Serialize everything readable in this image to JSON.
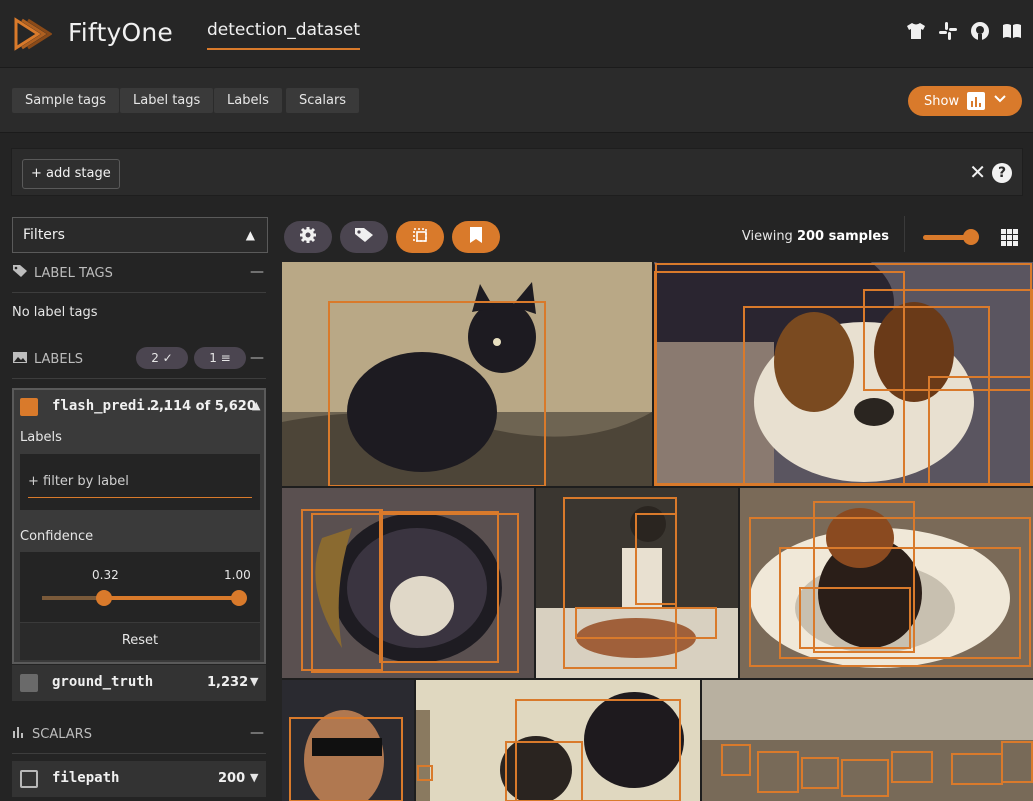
{
  "header": {
    "brand": "FiftyOne",
    "dataset_name": "detection_dataset",
    "icons": [
      "tshirt-icon",
      "slack-icon",
      "github-icon",
      "book-icon"
    ]
  },
  "tabs": [
    {
      "label": "Sample tags"
    },
    {
      "label": "Label tags"
    },
    {
      "label": "Labels"
    },
    {
      "label": "Scalars"
    }
  ],
  "show_button": {
    "label": "Show"
  },
  "stages": {
    "add_label": "+ add stage"
  },
  "sidebar": {
    "filters_title": "Filters",
    "label_tags": {
      "title": "LABEL TAGS",
      "empty_text": "No label tags"
    },
    "labels": {
      "title": "LABELS",
      "pill_checked": "2 ✓",
      "pill_filter": "1 ≡"
    },
    "flash_predictions": {
      "name": "flash_predi...",
      "count": "2,114 of 5,620",
      "labels_title": "Labels",
      "filter_placeholder": "+ filter by label",
      "confidence_title": "Confidence",
      "confidence_min": "0.32",
      "confidence_max": "1.00",
      "confidence_lower": 0.32,
      "confidence_upper": 1.0,
      "reset_label": "Reset"
    },
    "ground_truth": {
      "name": "ground_truth",
      "count": "1,232"
    },
    "scalars": {
      "title": "SCALARS"
    },
    "filepath": {
      "name": "filepath",
      "count": "200"
    }
  },
  "grid": {
    "viewing_prefix": "Viewing ",
    "viewing_count": "200 samples"
  },
  "colors": {
    "accent": "#d97a2b",
    "background": "#242424",
    "panel": "#2b2b2b"
  }
}
